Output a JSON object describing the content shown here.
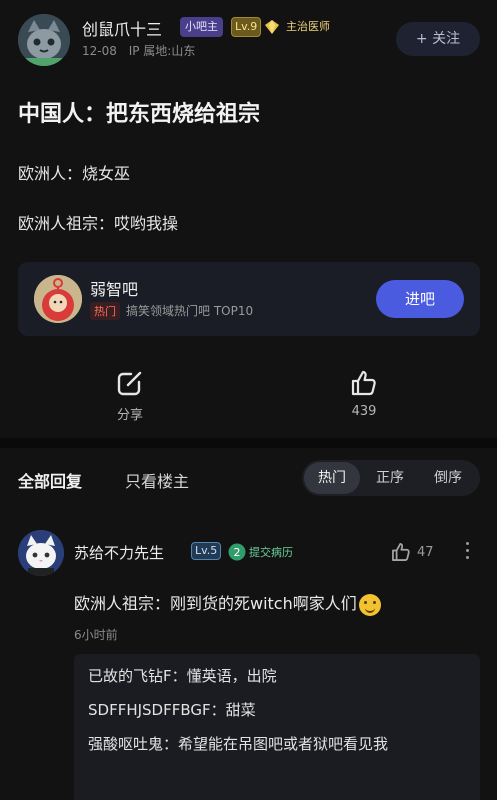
{
  "post": {
    "author": {
      "name": "创鼠爪十三",
      "badge_owner": "小吧主",
      "level": "Lv.9",
      "title_badge": "主治医师",
      "date": "12-08",
      "ip_location": "IP 属地:山东"
    },
    "follow_label": "+ 关注",
    "title": "中国人：把东西烧给祖宗",
    "lines": [
      "欧洲人：烧女巫",
      "欧洲人祖宗：哎哟我操"
    ],
    "forum_card": {
      "name": "弱智吧",
      "hot_tag": "热门",
      "description": "搞笑领域热门吧 TOP10",
      "enter_label": "进吧"
    },
    "actions": {
      "share_label": "分享",
      "like_count": "439"
    }
  },
  "comments_section": {
    "tab_all": "全部回复",
    "tab_op_only": "只看楼主",
    "sort": {
      "hot": "热门",
      "asc": "正序",
      "desc": "倒序"
    },
    "comment": {
      "author": "苏给不力先生",
      "level": "Lv.5",
      "badge_num": "2",
      "badge_text": "提交病历",
      "like_count": "47",
      "text": "欧洲人祖宗：刚到货的死witch啊家人们",
      "time": "6小时前",
      "replies": [
        "已故的飞钻F：懂英语，出院",
        "SDFFHJSDFFBGF：甜菜",
        "强酸呕吐鬼：希望能在吊图吧或者狱吧看见我"
      ]
    }
  },
  "colors": {
    "background": "#121212",
    "accent": "#4a5be0",
    "hot": "#ff6d5a"
  }
}
